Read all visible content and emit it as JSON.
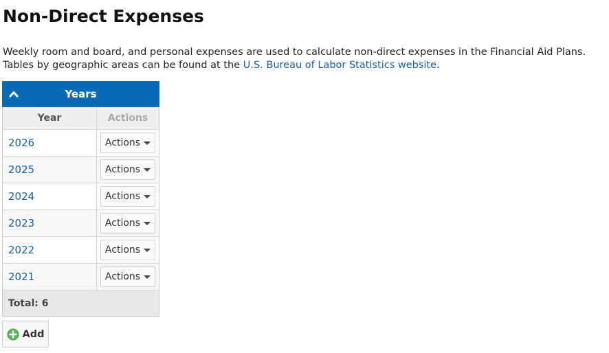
{
  "page": {
    "title": "Non-Direct Expenses",
    "intro_text": "Weekly room and board, and personal expenses are used to calculate non-direct expenses in the Financial Aid Plans. Tables by geographic areas can be found at the ",
    "intro_link": "U.S. Bureau of Labor Statistics website",
    "intro_end": "."
  },
  "panel": {
    "title": "Years",
    "collapse_icon": "chevron-up-icon",
    "header_color": "#0a6ab6"
  },
  "table": {
    "columns": [
      "Year",
      "Actions"
    ],
    "rows": [
      {
        "year": "2026",
        "action_label": "Actions"
      },
      {
        "year": "2025",
        "action_label": "Actions"
      },
      {
        "year": "2024",
        "action_label": "Actions"
      },
      {
        "year": "2023",
        "action_label": "Actions"
      },
      {
        "year": "2022",
        "action_label": "Actions"
      },
      {
        "year": "2021",
        "action_label": "Actions"
      }
    ],
    "total_label": "Total: 6"
  },
  "add_button": {
    "label": "Add",
    "icon": "plus-circle-icon",
    "icon_color": "#5cb85c"
  },
  "colors": {
    "link": "#1a5fa0"
  }
}
